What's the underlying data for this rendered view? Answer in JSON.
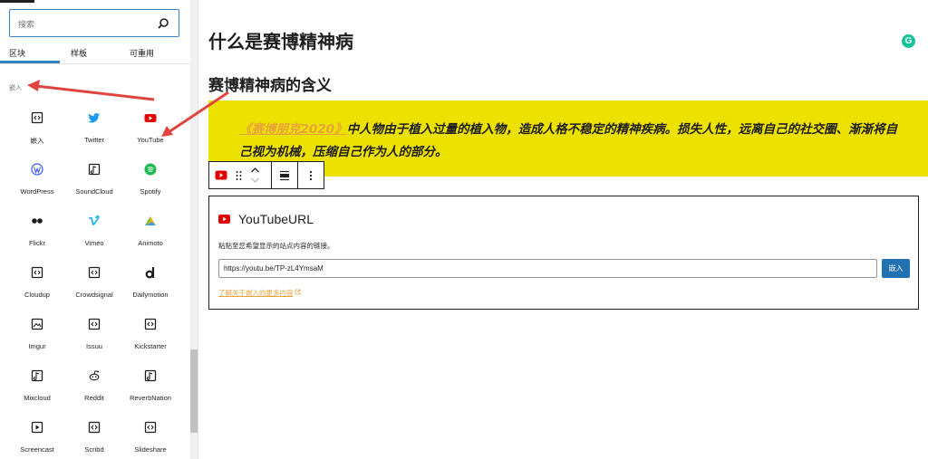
{
  "inserter": {
    "search_placeholder": "搜索",
    "tabs": [
      "区块",
      "样板",
      "可重用"
    ],
    "category": "嵌入",
    "blocks": [
      {
        "label": "嵌入",
        "icon": "embed-generic-icon"
      },
      {
        "label": "Twitter",
        "icon": "twitter-icon"
      },
      {
        "label": "YouTube",
        "icon": "youtube-icon"
      },
      {
        "label": "WordPress",
        "icon": "wordpress-icon"
      },
      {
        "label": "SoundCloud",
        "icon": "soundcloud-icon"
      },
      {
        "label": "Spotify",
        "icon": "spotify-icon"
      },
      {
        "label": "Flickr",
        "icon": "flickr-icon"
      },
      {
        "label": "Vimeo",
        "icon": "vimeo-icon"
      },
      {
        "label": "Animoto",
        "icon": "animoto-icon"
      },
      {
        "label": "Cloudup",
        "icon": "cloudup-icon"
      },
      {
        "label": "Crowdsignal",
        "icon": "crowdsignal-icon"
      },
      {
        "label": "Dailymotion",
        "icon": "dailymotion-icon"
      },
      {
        "label": "Imgur",
        "icon": "imgur-icon"
      },
      {
        "label": "Issuu",
        "icon": "issuu-icon"
      },
      {
        "label": "Kickstarter",
        "icon": "kickstarter-icon"
      },
      {
        "label": "Mixcloud",
        "icon": "mixcloud-icon"
      },
      {
        "label": "Reddit",
        "icon": "reddit-icon"
      },
      {
        "label": "ReverbNation",
        "icon": "reverbnation-icon"
      },
      {
        "label": "Screencast",
        "icon": "screencast-icon"
      },
      {
        "label": "Scribd",
        "icon": "scribd-icon"
      },
      {
        "label": "Slideshare",
        "icon": "slideshare-icon"
      }
    ]
  },
  "editor": {
    "heading1": "什么是赛博精神病",
    "heading2": "赛博精神病的含义",
    "quote_link": "《赛博朋克2020》",
    "quote_text": "中人物由于植入过量的植入物，造成人格不稳定的精神疾病。损失人性，远离自己的社交圈、渐渐将自己视为机械，压缩自己作为人的部分。",
    "grammarly_letter": "G",
    "embed": {
      "title": "YouTubeURL",
      "instructions": "粘贴至您希望显示的站点内容的链接。",
      "url_value": "https://youtu.be/TP-zL4YmsaM",
      "button": "嵌入",
      "learn_more": "了解关于嵌入的更多内容"
    }
  },
  "colors": {
    "accent": "#3582c4",
    "quote_bg": "#ede100",
    "link": "#e8a33a",
    "youtube": "#e00000",
    "button": "#2271b1",
    "annotation": "#e0443e"
  }
}
